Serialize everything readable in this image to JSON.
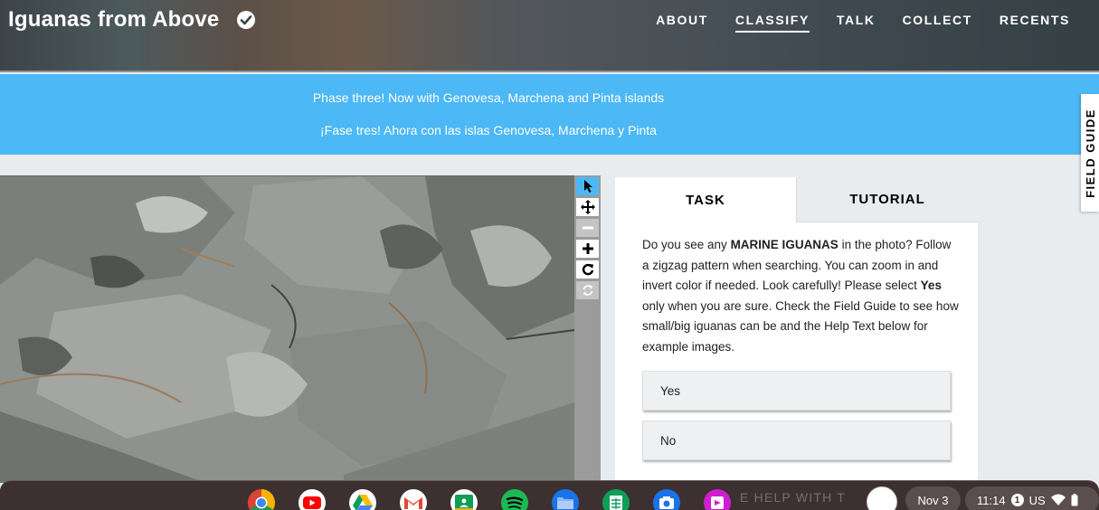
{
  "header": {
    "project_title": "Iguanas from Above",
    "nav": [
      {
        "label": "ABOUT",
        "active": false
      },
      {
        "label": "CLASSIFY",
        "active": true
      },
      {
        "label": "TALK",
        "active": false
      },
      {
        "label": "COLLECT",
        "active": false
      },
      {
        "label": "RECENTS",
        "active": false
      }
    ]
  },
  "banner": {
    "line_en": "Phase three! Now with Genovesa, Marchena and Pinta islands",
    "line_es": "¡Fase tres! Ahora con las islas Genovesa, Marchena y Pinta"
  },
  "field_guide": {
    "label": "FIELD GUIDE"
  },
  "toolbar": {
    "tools": [
      "pointer-icon",
      "move-icon",
      "zoom-out-icon",
      "zoom-in-icon",
      "rotate-icon",
      "reset-icon"
    ],
    "selected": "pointer-icon",
    "disabled": [
      "zoom-out-icon",
      "reset-icon"
    ]
  },
  "task_panel": {
    "tabs": [
      "TASK",
      "TUTORIAL"
    ],
    "question": {
      "t1": "Do you see any ",
      "b1": "MARINE IGUANAS",
      "t2": " in the photo? Follow a zigzag pattern when searching. You can zoom in and invert color if needed. Look carefully! Please select ",
      "b2": "Yes",
      "t3": " only when you are sure. Check the Field Guide to see how small/big iguanas can be and the Help Text below for example images."
    },
    "answers": [
      "Yes",
      "No"
    ],
    "help_partial": "E HELP WITH T"
  },
  "shelf": {
    "apps": [
      "chrome-icon",
      "youtube-icon",
      "drive-icon",
      "gmail-icon",
      "classroom-icon",
      "spotify-icon",
      "files-icon",
      "sheets-icon",
      "camera-icon",
      "screencast-icon"
    ],
    "date": "Nov 3",
    "time": "11:14",
    "notification_count": "1",
    "keyboard": "US"
  },
  "colors": {
    "banner": "#4cb8f5",
    "tool_selected": "#4cb8f5",
    "shelf": "#3d3030"
  }
}
